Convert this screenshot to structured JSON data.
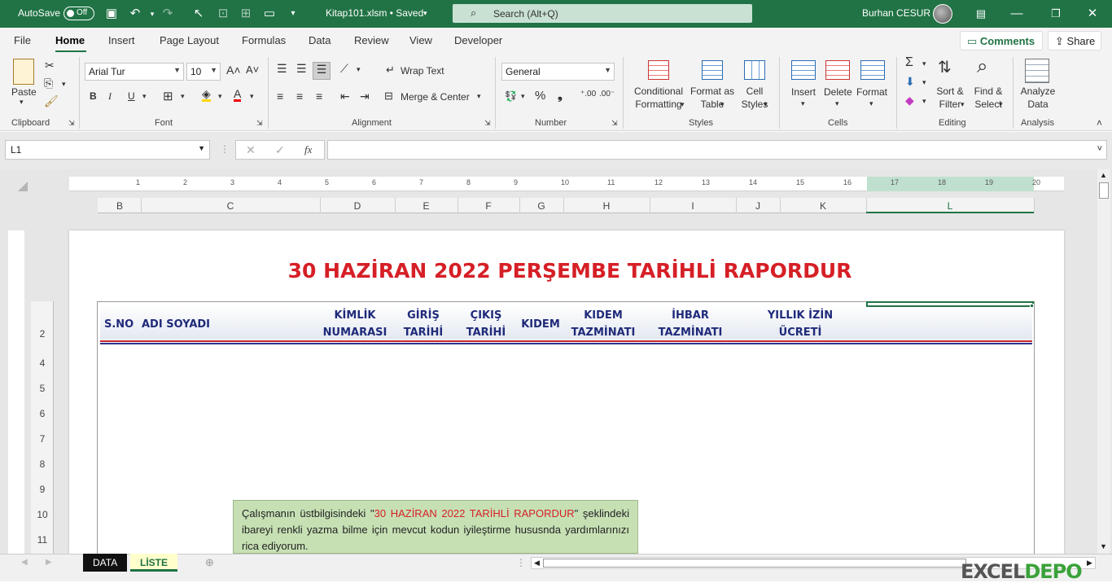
{
  "titlebar": {
    "autosave_label": "AutoSave",
    "autosave_state": "Off",
    "filename": "Kitap101.xlsm • Saved",
    "search_placeholder": "Search (Alt+Q)",
    "user": "Burhan CESUR"
  },
  "menu": {
    "items": [
      "File",
      "Home",
      "Insert",
      "Page Layout",
      "Formulas",
      "Data",
      "Review",
      "View",
      "Developer"
    ],
    "active": "Home",
    "comments": "Comments",
    "share": "Share"
  },
  "ribbon": {
    "clipboard": {
      "paste": "Paste",
      "label": "Clipboard"
    },
    "font": {
      "name": "Arial Tur",
      "size": "10",
      "bold": "B",
      "italic": "I",
      "underline": "U",
      "label": "Font"
    },
    "alignment": {
      "wrap": "Wrap Text",
      "merge": "Merge & Center",
      "label": "Alignment"
    },
    "number": {
      "format": "General",
      "label": "Number"
    },
    "styles": {
      "conditional_1": "Conditional",
      "conditional_2": "Formatting",
      "format_table_1": "Format as",
      "format_table_2": "Table",
      "cell_styles_1": "Cell",
      "cell_styles_2": "Styles",
      "label": "Styles"
    },
    "cells": {
      "insert": "Insert",
      "delete": "Delete",
      "format": "Format",
      "label": "Cells"
    },
    "editing": {
      "sort_1": "Sort &",
      "sort_2": "Filter",
      "find_1": "Find &",
      "find_2": "Select",
      "label": "Editing"
    },
    "analysis": {
      "analyze_1": "Analyze",
      "analyze_2": "Data",
      "label": "Analysis"
    }
  },
  "formula_bar": {
    "name_box": "L1",
    "formula": ""
  },
  "ruler_numbers": [
    "1",
    "2",
    "3",
    "4",
    "5",
    "6",
    "7",
    "8",
    "9",
    "10",
    "11",
    "12",
    "13",
    "14",
    "15",
    "16",
    "17",
    "18",
    "19",
    "20"
  ],
  "columns": [
    "B",
    "C",
    "D",
    "E",
    "F",
    "G",
    "H",
    "I",
    "J",
    "K",
    "L"
  ],
  "rows": [
    "2",
    "4",
    "5",
    "6",
    "7",
    "8",
    "9",
    "10",
    "11"
  ],
  "report": {
    "title": "30 HAZİRAN 2022 PERŞEMBE TARİHLİ RAPORDUR",
    "headers": {
      "sno": "S.NO",
      "name": "ADI SOYADI",
      "tc_1": "KİMLİK",
      "tc_2": "NUMARASI",
      "giris_1": "GİRİŞ",
      "giris_2": "TARİHİ",
      "cikis_1": "ÇIKIŞ",
      "cikis_2": "TARİHİ",
      "kidem": "KIDEM",
      "kt_1": "KIDEM",
      "kt_2": "TAZMİNATI",
      "ihbar_1": "İHBAR",
      "ihbar_2": "TAZMİNATI",
      "izin_1": "YILLIK İZİN",
      "izin_2": "ÜCRETİ"
    }
  },
  "note": {
    "part1": "Çalışmanın üstbilgisindeki \"",
    "highlight": "30 HAZİRAN 2022 TARİHLİ RAPORDUR",
    "part2": "\" şeklindeki ibareyi renkli yazma bilme için  mevcut kodun  iyileştirme hususnda yardımlarınızı rica ediyorum."
  },
  "sheets": {
    "tab1": "DATA",
    "tab2": "LİSTE",
    "active": "LİSTE"
  },
  "watermark": {
    "part1": "EXCEL",
    "part2": "DEPO"
  },
  "colors": {
    "brand_green": "#217346",
    "title_red": "#d61f26",
    "header_blue": "#1f2a7a",
    "note_bg": "#c6e0b4"
  }
}
